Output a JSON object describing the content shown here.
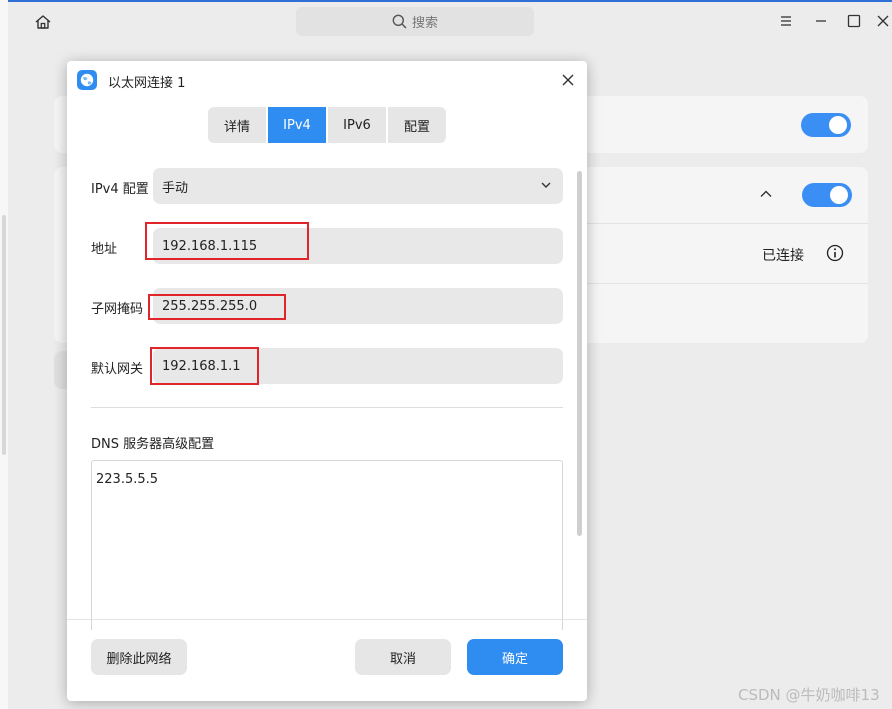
{
  "background": {
    "search_placeholder": "搜索",
    "connected_status": "已连接",
    "watermark": "CSDN @牛奶咖啡13",
    "accent_color": "#3a8ef4"
  },
  "dialog": {
    "title": "以太网连接 1",
    "tabs": [
      {
        "label": "详情",
        "active": false
      },
      {
        "label": "IPv4",
        "active": true
      },
      {
        "label": "IPv6",
        "active": false
      },
      {
        "label": "配置",
        "active": false
      }
    ],
    "ipv4_config": {
      "label": "IPv4 配置",
      "value": "手动"
    },
    "address": {
      "label": "地址",
      "value": "192.168.1.115"
    },
    "subnet": {
      "label": "子网掩码",
      "value": "255.255.255.0"
    },
    "gateway": {
      "label": "默认网关",
      "value": "192.168.1.1"
    },
    "dns": {
      "label": "DNS 服务器高级配置",
      "value": "223.5.5.5"
    },
    "buttons": {
      "delete": "删除此网络",
      "cancel": "取消",
      "confirm": "确定"
    },
    "highlight_color": "#e0262a"
  }
}
